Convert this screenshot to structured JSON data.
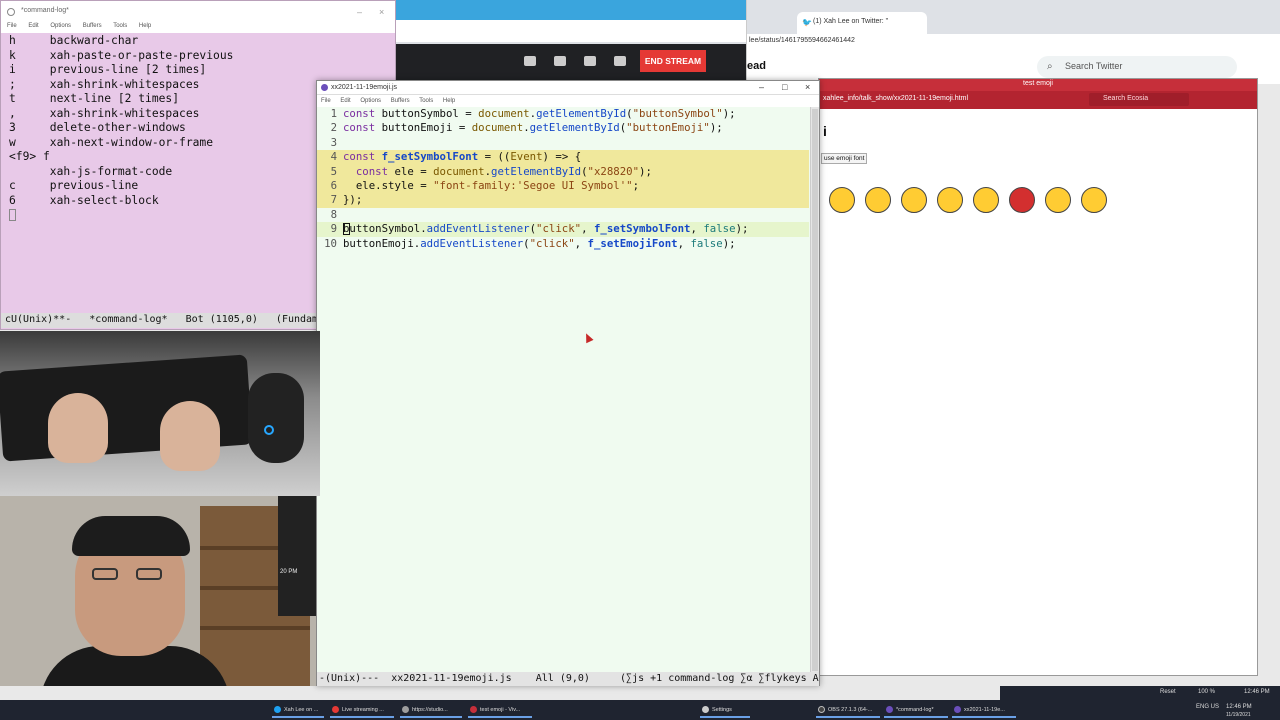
{
  "cmdlog": {
    "title": "*command-log*",
    "menu": [
      "File",
      "Edit",
      "Options",
      "Buffers",
      "Tools",
      "Help"
    ],
    "lines": [
      "h     backward-char",
      "k     xah-paste-or-paste-previous",
      "i     previous-line [2 times]",
      ";     xah-shrink-whitespaces",
      "t     next-line [2 times]",
      ",     xah-shrink-whitespaces",
      "3     delete-other-windows",
      "w     xah-next-window-or-frame",
      "<f9> f",
      "      xah-js-format-code",
      "c     previous-line",
      "6     xah-select-block"
    ],
    "modeline": "cU(Unix)**-   *command-log*   Bot (1105,0)   (Fundam"
  },
  "studio": {
    "end_stream": "END STREAM"
  },
  "twitter": {
    "tab_title": "(1) Xah Lee on Twitter: \"",
    "url": "lee/status/1461795594662461442",
    "lead": "ead",
    "search_placeholder": "Search Twitter"
  },
  "emoji_page": {
    "title": "test emoji",
    "url": "xahlee_info/talk_show/xx2021-11-19emoji.html",
    "search_placeholder": "Search Ecosia",
    "heading": "i",
    "button_label": "use emoji font",
    "emoji_count": 8
  },
  "emacs": {
    "title": "xx2021-11-19emoji.js",
    "menu": [
      "File",
      "Edit",
      "Options",
      "Buffers",
      "Tools",
      "Help"
    ],
    "modeline": "-(Unix)---  xx2021-11-19emoji.js    All (9,0)     (∑js +1 command-log ∑α ∑flykeys A",
    "code": [
      {
        "n": "1",
        "t": [
          [
            "kw",
            "const "
          ],
          [
            "pl",
            "buttonSymbol = "
          ],
          [
            "var",
            "document"
          ],
          [
            "pl",
            "."
          ],
          [
            "fn",
            "getElementById"
          ],
          [
            "pl",
            "("
          ],
          [
            "str",
            "\"buttonSymbol\""
          ],
          [
            "pl",
            ");"
          ]
        ]
      },
      {
        "n": "2",
        "t": [
          [
            "kw",
            "const "
          ],
          [
            "pl",
            "buttonEmoji = "
          ],
          [
            "var",
            "document"
          ],
          [
            "pl",
            "."
          ],
          [
            "fn",
            "getElementById"
          ],
          [
            "pl",
            "("
          ],
          [
            "str",
            "\"buttonEmoji\""
          ],
          [
            "pl",
            ");"
          ]
        ]
      },
      {
        "n": "3",
        "t": []
      },
      {
        "n": "4",
        "t": [
          [
            "kw",
            "const "
          ],
          [
            "fnb",
            "f_setSymbolFont"
          ],
          [
            "pl",
            " = (("
          ],
          [
            "var",
            "Event"
          ],
          [
            "pl",
            ") => {"
          ]
        ]
      },
      {
        "n": "5",
        "t": [
          [
            "pl",
            "  "
          ],
          [
            "kw",
            "const "
          ],
          [
            "pl",
            "ele = "
          ],
          [
            "var",
            "document"
          ],
          [
            "pl",
            "."
          ],
          [
            "fn",
            "getElementById"
          ],
          [
            "pl",
            "("
          ],
          [
            "str",
            "\"x28820\""
          ],
          [
            "pl",
            ");"
          ]
        ]
      },
      {
        "n": "6",
        "t": [
          [
            "pl",
            "  ele.style = "
          ],
          [
            "str",
            "\"font-family:'Segoe UI Symbol'\""
          ],
          [
            "pl",
            ";"
          ]
        ]
      },
      {
        "n": "7",
        "t": [
          [
            "pl",
            "});"
          ]
        ]
      },
      {
        "n": "8",
        "t": []
      },
      {
        "n": "9",
        "t": [
          [
            "pl",
            "buttonSymbol."
          ],
          [
            "fn",
            "addEventListener"
          ],
          [
            "pl",
            "("
          ],
          [
            "str",
            "\"click\""
          ],
          [
            "pl",
            ", "
          ],
          [
            "fnb",
            "f_setSymbolFont"
          ],
          [
            "pl",
            ", "
          ],
          [
            "cst",
            "false"
          ],
          [
            "pl",
            ");"
          ]
        ]
      },
      {
        "n": "10",
        "t": [
          [
            "pl",
            "buttonEmoji."
          ],
          [
            "fn",
            "addEventListener"
          ],
          [
            "pl",
            "("
          ],
          [
            "str",
            "\"click\""
          ],
          [
            "pl",
            ", "
          ],
          [
            "fnb",
            "f_setEmojiFont"
          ],
          [
            "pl",
            ", "
          ],
          [
            "cst",
            "false"
          ],
          [
            "pl",
            ");"
          ]
        ]
      }
    ]
  },
  "webcam": {
    "tv_text": "20 PM"
  },
  "taskbar": {
    "tasks": [
      "Xah Lee on ...",
      "Live streaming ...",
      "https://studio...",
      "test emoji - Viv...",
      "Settings",
      "OBS 27.1.3 (64-...",
      "*command-log*",
      "xx2021-11-19e..."
    ],
    "zoom": "100 %",
    "reset": "Reset",
    "clock": "12:46 PM",
    "date": "11/19/2021",
    "lang": "ENG US"
  },
  "colors": {
    "cmdlog_bg": "#e8c9e8",
    "emacs_bg": "#f0fbf0",
    "highlight": "#f0e89c",
    "end_stream": "#e53935",
    "browser_red": "#c62f3a"
  }
}
